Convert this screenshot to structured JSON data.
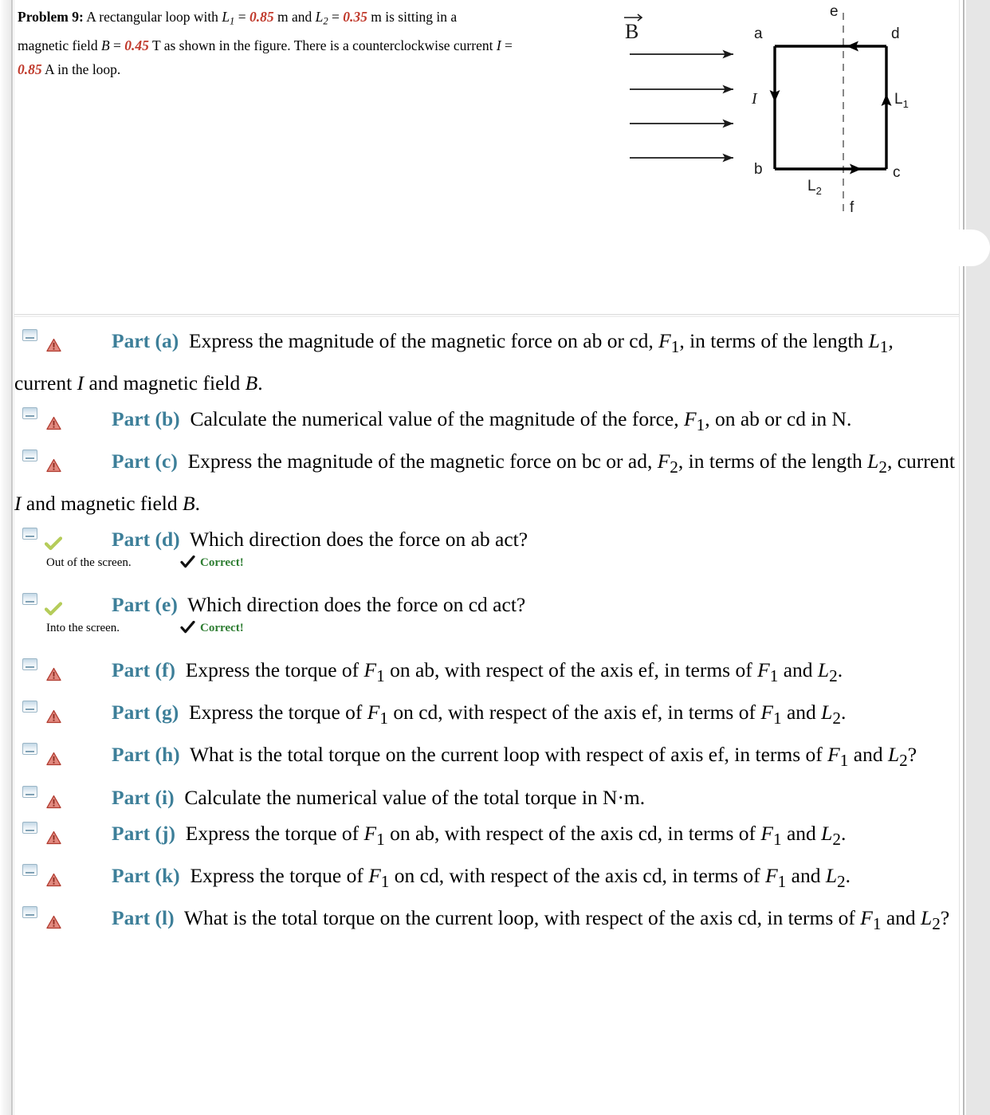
{
  "statement": {
    "lead": "Problem 9:",
    "text_1": "  A rectangular loop with ",
    "L1_sym": "L",
    "L1_sub": "1",
    "eq1": " = ",
    "L1_val": "0.85",
    "unit1": " m and ",
    "L2_sym": "L",
    "L2_sub": "2",
    "eq2": " = ",
    "L2_val": "0.35",
    "unit2": " m is sitting in a",
    "line2_a": "magnetic field ",
    "B_sym": "B",
    "eq3": " = ",
    "B_val": "0.45",
    "unit3": " T as shown in the figure. There is a counterclockwise current ",
    "I_sym": "I",
    "eq4": " = ",
    "line3_a": "0.85",
    "line3_b": " A in the loop."
  },
  "figure": {
    "b_field_label": "B",
    "current_label": "I",
    "corner_a": "a",
    "corner_b": "b",
    "corner_c": "c",
    "corner_d": "d",
    "axis_top": "e",
    "axis_bottom": "f",
    "len_long": "L",
    "len_long_sub": "1",
    "len_short": "L",
    "len_short_sub": "2",
    "arrow_count": 4
  },
  "colors": {
    "part_label": "#3d7f99",
    "number_red": "#c0392b",
    "correct_green": "#2e7d32",
    "warn_red": "#d24b4b",
    "check_green": "#b5cc5a",
    "divider": "#d9d9d9"
  },
  "parts": [
    {
      "id": "a",
      "status": "warning",
      "label": "Part (a)",
      "question_html": "Express the magnitude of the magnetic force on ab or cd, <i>F</i><sub>1</sub>, in terms of the length <i>L</i><sub>1</sub>, current <i>I</i> and magnetic field <i>B</i>.",
      "question_plain": "Express the magnitude of the magnetic force on ab or cd, F1, in terms of the length L1, current I and magnetic field B."
    },
    {
      "id": "b",
      "status": "warning",
      "label": "Part (b)",
      "question_html": "Calculate the numerical value of the magnitude of the force, <i>F</i><sub>1</sub>, on ab or cd in N.",
      "question_plain": "Calculate the numerical value of the magnitude of the force, F1, on ab or cd in N."
    },
    {
      "id": "c",
      "status": "warning",
      "label": "Part (c)",
      "question_html": "Express the magnitude of the magnetic force on bc or ad, <i>F</i><sub>2</sub>, in terms of the length <i>L</i><sub>2</sub>, current <i>I</i> and magnetic field <i>B</i>.",
      "question_plain": "Express the magnitude of the magnetic force on bc or ad, F2, in terms of the length L2, current I and magnetic field B."
    },
    {
      "id": "d",
      "status": "correct",
      "label": "Part (d)",
      "question_html": "Which direction does the force on ab act?",
      "question_plain": "Which direction does the force on ab act?",
      "answer": "Out of the screen.",
      "feedback": "Correct!"
    },
    {
      "id": "e",
      "status": "correct",
      "label": "Part (e)",
      "question_html": "Which direction does the force on cd act?",
      "question_plain": "Which direction does the force on cd act?",
      "answer": "Into the screen.",
      "feedback": "Correct!"
    },
    {
      "id": "f",
      "status": "warning",
      "label": "Part (f)",
      "question_html": "Express the torque of <i>F</i><sub>1</sub> on ab, with respect of the axis ef, in terms of <i>F</i><sub>1</sub> and <i>L</i><sub>2</sub>.",
      "question_plain": "Express the torque of F1 on ab, with respect of the axis ef, in terms of F1 and L2."
    },
    {
      "id": "g",
      "status": "warning",
      "label": "Part (g)",
      "question_html": "Express the torque of <i>F</i><sub>1</sub> on cd, with respect of the axis ef, in terms of <i>F</i><sub>1</sub> and <i>L</i><sub>2</sub>.",
      "question_plain": "Express the torque of F1 on cd, with respect of the axis ef, in terms of F1 and L2."
    },
    {
      "id": "h",
      "status": "warning",
      "label": "Part (h)",
      "question_html": "What is the total torque on the current loop with respect of axis ef, in terms of <i>F</i><sub>1</sub> and <i>L</i><sub>2</sub>?",
      "question_plain": "What is the total torque on the current loop with respect of axis ef, in terms of F1 and L2?"
    },
    {
      "id": "i",
      "status": "warning",
      "label": "Part (i)",
      "question_html": "Calculate the numerical value of the total torque in N&#183;m.",
      "question_plain": "Calculate the numerical value of the total torque in N·m."
    },
    {
      "id": "j",
      "status": "warning",
      "label": "Part (j)",
      "question_html": "Express the torque of <i>F</i><sub>1</sub> on ab, with respect of the axis cd, in terms of <i>F</i><sub>1</sub> and <i>L</i><sub>2</sub>.",
      "question_plain": "Express the torque of F1 on ab, with respect of the axis cd, in terms of F1 and L2."
    },
    {
      "id": "k",
      "status": "warning",
      "label": "Part (k)",
      "question_html": "Express the torque of <i>F</i><sub>1</sub> on cd, with respect of the axis cd, in terms of <i>F</i><sub>1</sub> and <i>L</i><sub>2</sub>.",
      "question_plain": "Express the torque of F1 on cd, with respect of the axis cd, in terms of F1 and L2."
    },
    {
      "id": "l",
      "status": "warning",
      "label": "Part (l)",
      "question_html": "What is the total torque on the current loop, with respect of the axis cd, in terms of <i>F</i><sub>1</sub> and <i>L</i><sub>2</sub>?",
      "question_plain": "What is the total torque on the current loop, with respect of the axis cd, in terms of F1 and L2?"
    }
  ]
}
